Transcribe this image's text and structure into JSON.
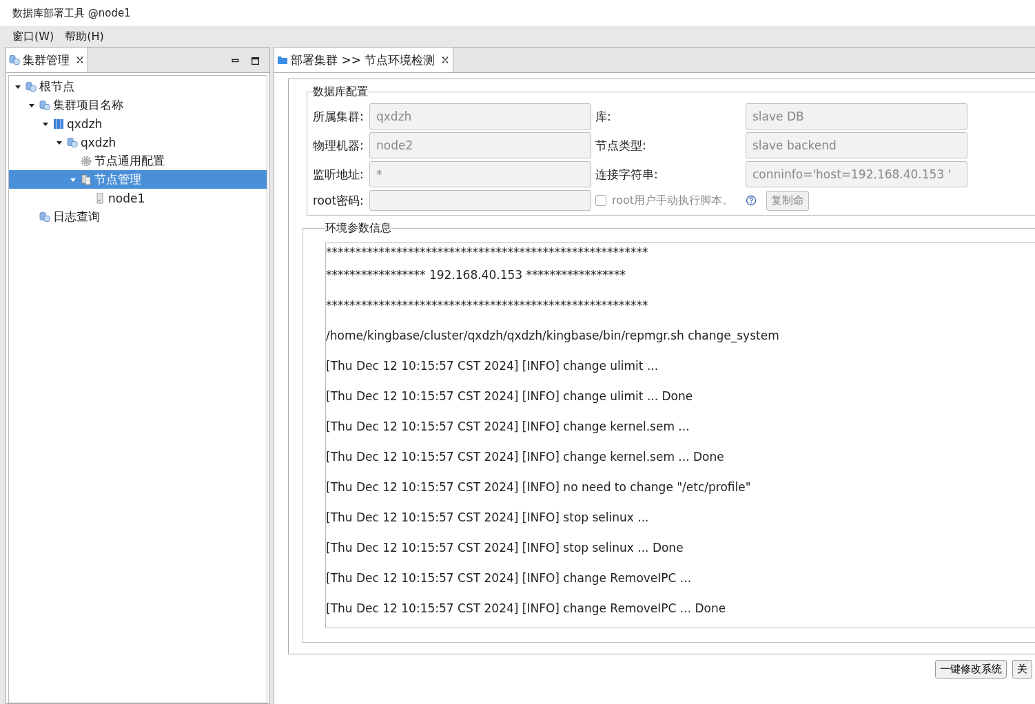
{
  "window": {
    "title": "数据库部署工具 @node1"
  },
  "menu": [
    {
      "label": "窗口(W)"
    },
    {
      "label": "帮助(H)"
    }
  ],
  "left_panel": {
    "tab": {
      "label": "集群管理",
      "selected": true
    },
    "tree": [
      {
        "label": "根节点",
        "kind": "cluster",
        "expanded": true,
        "selected": false,
        "children": [
          {
            "label": "集群项目名称",
            "kind": "cluster",
            "expanded": true,
            "selected": false,
            "children": [
              {
                "label": "qxdzh",
                "kind": "server",
                "expanded": true,
                "selected": false,
                "children": [
                  {
                    "label": "qxdzh",
                    "kind": "cluster",
                    "expanded": true,
                    "selected": false,
                    "children": [
                      {
                        "label": "节点通用配置",
                        "kind": "gear",
                        "selected": false
                      },
                      {
                        "label": "节点管理",
                        "kind": "nodes",
                        "expanded": true,
                        "selected": true,
                        "children": [
                          {
                            "label": "node1",
                            "kind": "node",
                            "selected": false
                          }
                        ]
                      }
                    ]
                  }
                ]
              }
            ]
          },
          {
            "label": "日志查询",
            "kind": "cluster",
            "selected": false
          }
        ]
      }
    ]
  },
  "right_panel": {
    "tab": {
      "label": "部署集群 >> 节点环境检测",
      "selected": true
    },
    "db_config": {
      "title": "数据库配置",
      "rows": [
        {
          "label": "所属集群:",
          "value": "qxdzh",
          "label2": "库:",
          "value2": "slave DB"
        },
        {
          "label": "物理机器:",
          "value": "node2",
          "label2": "节点类型:",
          "value2": "slave backend"
        },
        {
          "label": "监听地址:",
          "value": "*",
          "label2": "连接字符串:",
          "value2": "conninfo='host=192.168.40.153 '"
        }
      ],
      "root_password": {
        "label": "root密码:"
      },
      "manual_script": {
        "label": "root用户手动执行脚本。",
        "checked": false
      },
      "copy_button": "复制命"
    },
    "env_info": {
      "title": "环境参数信息",
      "log": [
        "*******************************************************",
        "***************** 192.168.40.153 *****************",
        "*******************************************************",
        "/home/kingbase/cluster/qxdzh/qxdzh/kingbase/bin/repmgr.sh change_system",
        "[Thu Dec 12 10:15:57 CST 2024] [INFO] change ulimit ...",
        "[Thu Dec 12 10:15:57 CST 2024] [INFO] change ulimit ... Done",
        "[Thu Dec 12 10:15:57 CST 2024] [INFO] change kernel.sem ...",
        "[Thu Dec 12 10:15:57 CST 2024] [INFO] change kernel.sem ... Done",
        "[Thu Dec 12 10:15:57 CST 2024] [INFO] no need to change \"/etc/profile\"",
        "[Thu Dec 12 10:15:57 CST 2024] [INFO] stop selinux ...",
        "[Thu Dec 12 10:15:57 CST 2024] [INFO] stop selinux ... Done",
        "[Thu Dec 12 10:15:57 CST 2024] [INFO] change RemoveIPC ...",
        "[Thu Dec 12 10:15:57 CST 2024] [INFO] change RemoveIPC ... Done"
      ]
    },
    "buttons": [
      "一键修改系统",
      "关"
    ]
  }
}
